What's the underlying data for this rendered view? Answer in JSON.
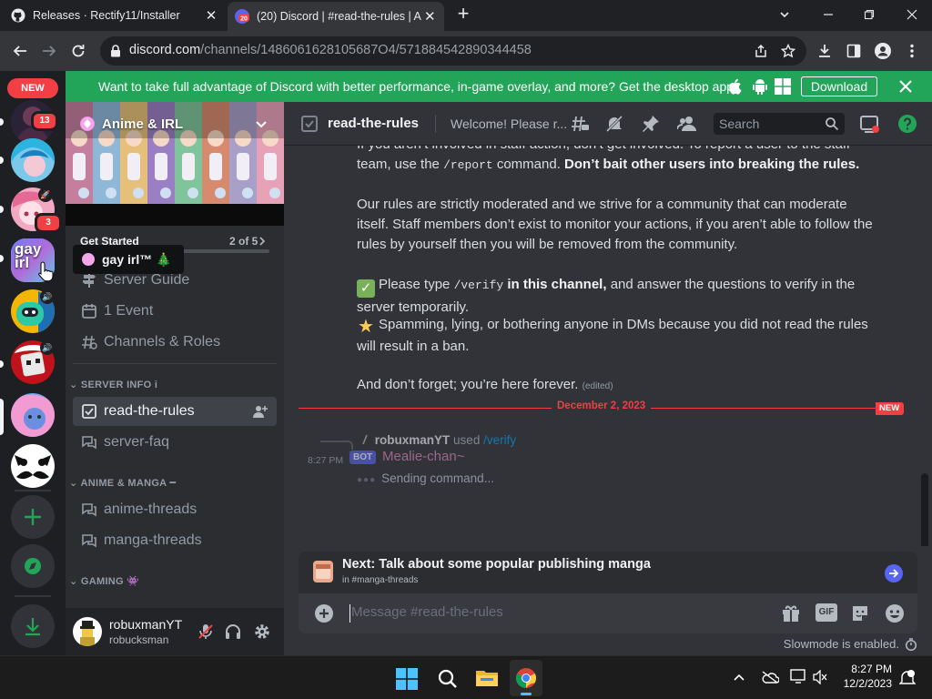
{
  "browser": {
    "tabs": [
      {
        "title": "Releases · Rectify11/Installer",
        "active": false
      },
      {
        "title": "(20) Discord | #read-the-rules | A",
        "active": true,
        "badge": "20"
      }
    ],
    "url_host": "discord.com",
    "url_path": "/channels/1486061628105687O4/571884542890344458"
  },
  "banner": {
    "text": "Want to take full advantage of Discord with better performance, in-game overlay, and more? Get the desktop app!",
    "download_label": "Download",
    "color": "#23a559"
  },
  "guilds": {
    "new_label": "NEW",
    "badge_1": "13",
    "badge_2": "3",
    "tooltip": "gay irl™ 🎄",
    "gay_text": "gay irl"
  },
  "server": {
    "name": "Anime & IRL",
    "get_started": "Get Started",
    "progress_text": "2 of 5",
    "progress_fraction": 0.4,
    "items": [
      "Server Guide",
      "1 Event",
      "Channels & Roles"
    ],
    "categories": {
      "info": "SERVER INFO i",
      "anime": "ANIME & MANGA ━",
      "gaming": "GAMING 👾"
    },
    "channels": {
      "rules": "read-the-rules",
      "faq": "server-faq",
      "anime_threads": "anime-threads",
      "manga_threads": "manga-threads"
    }
  },
  "user": {
    "display_name": "robuxmanYT",
    "username": "robucksman"
  },
  "chat": {
    "channel_name": "read-the-rules",
    "topic": "Welcome! Please r...",
    "search_placeholder": "Search",
    "msg1_a": "If you aren’t involved in staff action, don’t get involved. To report a user to the staff team, use the ",
    "msg1_code": "/report",
    "msg1_b": " command. ",
    "msg1_bold": "Don’t bait other users into breaking the rules.",
    "msg2": "Our rules are strictly moderated and we strive for a community that can moderate itself. Staff members don’t exist to monitor your actions, if you aren’t able to follow the rules by yourself then you will be removed from the community.",
    "msg3_a": "Please type ",
    "msg3_code": "/verify",
    "msg3_bold": " in this channel,",
    "msg3_b": " and answer the questions to verify in the server temporarily.",
    "msg4": "Spamming, lying, or bothering anyone in DMs because you did not read the rules will result in a ban.",
    "msg5": "And don’t forget; you’re here forever.",
    "edited": "(edited)",
    "date_divider": "December 2, 2023",
    "new_label": "NEW",
    "reply_user": "robuxmanYT",
    "reply_used": "used",
    "reply_command": "/verify",
    "bot_time": "8:27 PM",
    "bot_tag": "BOT",
    "bot_name": "Mealie-chan~",
    "sending": "Sending command...",
    "next_title": "Next: Talk about some popular publishing manga",
    "next_sub": "in #manga-threads",
    "composer_placeholder": "Message #read-the-rules",
    "slowmode": "Slowmode is enabled."
  },
  "taskbar": {
    "time": "8:27 PM",
    "date": "12/2/2023"
  }
}
